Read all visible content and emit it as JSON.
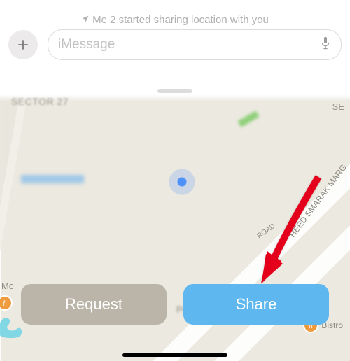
{
  "notification": {
    "icon": "➤",
    "text": "Me 2 started sharing location with you"
  },
  "composer": {
    "placeholder": "iMessage"
  },
  "map": {
    "sector_label": "SECTOR 27",
    "road_label": "ROAD",
    "marg_label": "HEED SMARAK MARG",
    "poi_bistro": "Bistro",
    "poi_mc": "Mc",
    "poi_publ": "Publ",
    "se_label": "SE"
  },
  "actions": {
    "request": "Request",
    "share": "Share"
  }
}
